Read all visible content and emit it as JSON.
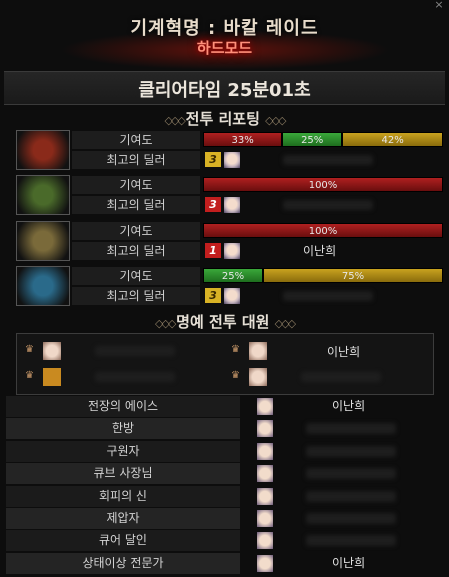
{
  "window": {
    "title": "기계혁명 : 바칼 레이드",
    "difficulty": "하드모드",
    "close_icon": "×"
  },
  "clear_time": "클리어타임  25분01초",
  "battle_report": {
    "heading": "전투 리포팅",
    "contribution_label": "기여도",
    "top_dealer_label": "최고의 딜러",
    "bosses": [
      {
        "icon": "red-dragon-icon",
        "color": "#8a2a1a",
        "bars": [
          {
            "label": "33%",
            "value": 33,
            "color": "red"
          },
          {
            "label": "25%",
            "value": 25,
            "color": "green"
          },
          {
            "label": "42%",
            "value": 42,
            "color": "gold"
          }
        ],
        "dealer_tier": "3",
        "dealer_tier_color": "gold",
        "dealer_name": ""
      },
      {
        "icon": "green-dragon-icon",
        "color": "#4a6a2a",
        "bars": [
          {
            "label": "100%",
            "value": 100,
            "color": "red"
          }
        ],
        "dealer_tier": "3",
        "dealer_tier_color": "red",
        "dealer_name": ""
      },
      {
        "icon": "gold-dragon-icon",
        "color": "#7a6a3a",
        "bars": [
          {
            "label": "100%",
            "value": 100,
            "color": "red"
          }
        ],
        "dealer_tier": "1",
        "dealer_tier_color": "red",
        "dealer_name": "이난희"
      },
      {
        "icon": "blue-dragon-icon",
        "color": "#2a6a8a",
        "bars": [
          {
            "label": "25%",
            "value": 25,
            "color": "green"
          },
          {
            "label": "75%",
            "value": 75,
            "color": "gold"
          }
        ],
        "dealer_tier": "3",
        "dealer_tier_color": "gold",
        "dealer_name": ""
      }
    ]
  },
  "honor": {
    "heading": "명예 전투 대원",
    "members": [
      {
        "name": "",
        "icon": "crown-icon"
      },
      {
        "name": "이난희",
        "icon": "crown-icon"
      },
      {
        "name": "",
        "icon": "crown-icon"
      },
      {
        "name": "",
        "icon": "crown-icon"
      }
    ]
  },
  "awards": [
    {
      "label": "전장의 에이스",
      "name": "이난희"
    },
    {
      "label": "한방",
      "name": ""
    },
    {
      "label": "구원자",
      "name": ""
    },
    {
      "label": "큐브 사장님",
      "name": ""
    },
    {
      "label": "회피의 신",
      "name": ""
    },
    {
      "label": "제압자",
      "name": ""
    },
    {
      "label": "큐어 달인",
      "name": ""
    },
    {
      "label": "상태이상 전문가",
      "name": "이난희"
    }
  ]
}
